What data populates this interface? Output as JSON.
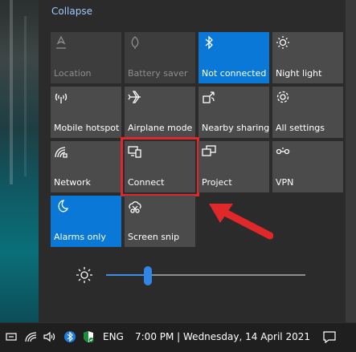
{
  "action_center": {
    "collapse_label": "Collapse",
    "tiles": [
      {
        "label": "Location",
        "state": "disabled",
        "icon": "location-icon"
      },
      {
        "label": "Battery saver",
        "state": "disabled",
        "icon": "battery-saver-icon"
      },
      {
        "label": "Not connected",
        "state": "on",
        "icon": "bluetooth-icon"
      },
      {
        "label": "Night light",
        "state": "off",
        "icon": "night-light-icon"
      },
      {
        "label": "Mobile hotspot",
        "state": "off",
        "icon": "mobile-hotspot-icon"
      },
      {
        "label": "Airplane mode",
        "state": "off",
        "icon": "airplane-icon"
      },
      {
        "label": "Nearby sharing",
        "state": "off",
        "icon": "nearby-sharing-icon"
      },
      {
        "label": "All settings",
        "state": "off",
        "icon": "settings-gear-icon"
      },
      {
        "label": "Network",
        "state": "off",
        "icon": "network-icon"
      },
      {
        "label": "Connect",
        "state": "off",
        "icon": "connect-icon",
        "highlighted": true
      },
      {
        "label": "Project",
        "state": "off",
        "icon": "project-icon"
      },
      {
        "label": "VPN",
        "state": "off",
        "icon": "vpn-icon"
      },
      {
        "label": "Alarms only",
        "state": "on",
        "icon": "moon-icon"
      },
      {
        "label": "Screen snip",
        "state": "off",
        "icon": "screen-snip-icon"
      }
    ],
    "brightness": {
      "value_fraction": 0.21,
      "icon": "brightness-sun-icon"
    }
  },
  "taskbar": {
    "language": "ENG",
    "datetime": "7:00 PM | Wednesday, 14 April 2021",
    "icons": [
      "taskbar-app-icon",
      "wifi-icon",
      "volume-icon",
      "bluetooth-tray-icon",
      "security-shield-icon",
      "notification-icon"
    ]
  },
  "colors": {
    "accent": "#0a78d7",
    "highlight": "#e0282a",
    "tile": "#4b4b4b",
    "panel": "#2b2b2b"
  }
}
